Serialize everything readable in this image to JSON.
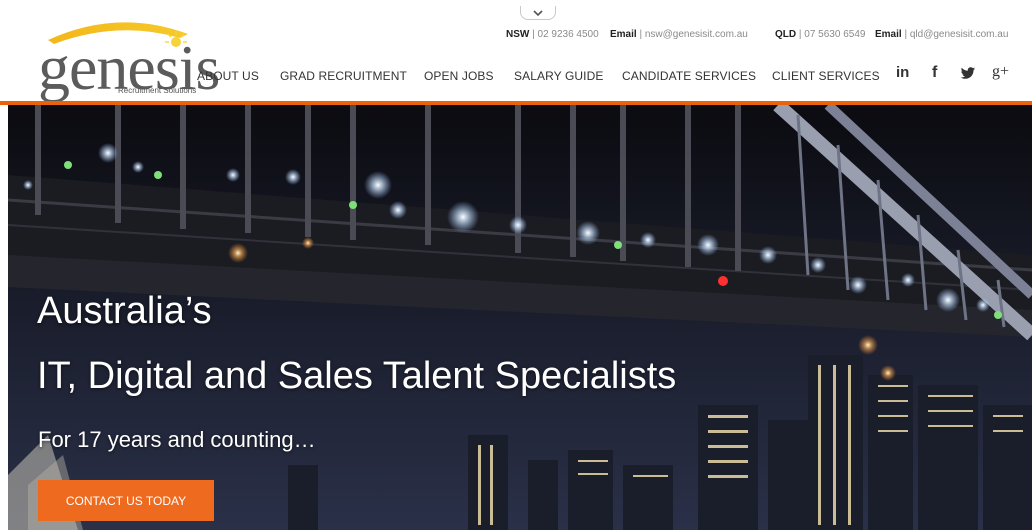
{
  "colors": {
    "accent": "#e9630d",
    "cta": "#ee6a1f",
    "nav_text": "#333333"
  },
  "logo": {
    "wordmark": "genesis",
    "tagline": "Recruitment Solutions"
  },
  "contact": {
    "nsw_label": "NSW",
    "nsw_phone": "| 02 9236 4500",
    "nsw_email_label": "Email",
    "nsw_email": "| nsw@genesisit.com.au",
    "qld_label": "QLD",
    "qld_phone": "| 07 5630 6549",
    "qld_email_label": "Email",
    "qld_email": "| qld@genesisit.com.au"
  },
  "nav": {
    "items": [
      {
        "label": "ABOUT US"
      },
      {
        "label": "GRAD RECRUITMENT"
      },
      {
        "label": "OPEN JOBS"
      },
      {
        "label": "SALARY GUIDE"
      },
      {
        "label": "CANDIDATE SERVICES"
      },
      {
        "label": "CLIENT SERVICES"
      }
    ]
  },
  "social": {
    "icons": [
      "linkedin-icon",
      "facebook-icon",
      "twitter-icon",
      "google-plus-icon"
    ],
    "linkedin": "in",
    "facebook": "f",
    "google_plus": "g+"
  },
  "hero": {
    "heading_line1": "Australia’s",
    "heading_line2": "IT, Digital and Sales Talent Specialists",
    "subheading": "For 17 years and counting…",
    "cta_label": "CONTACT US TODAY"
  }
}
